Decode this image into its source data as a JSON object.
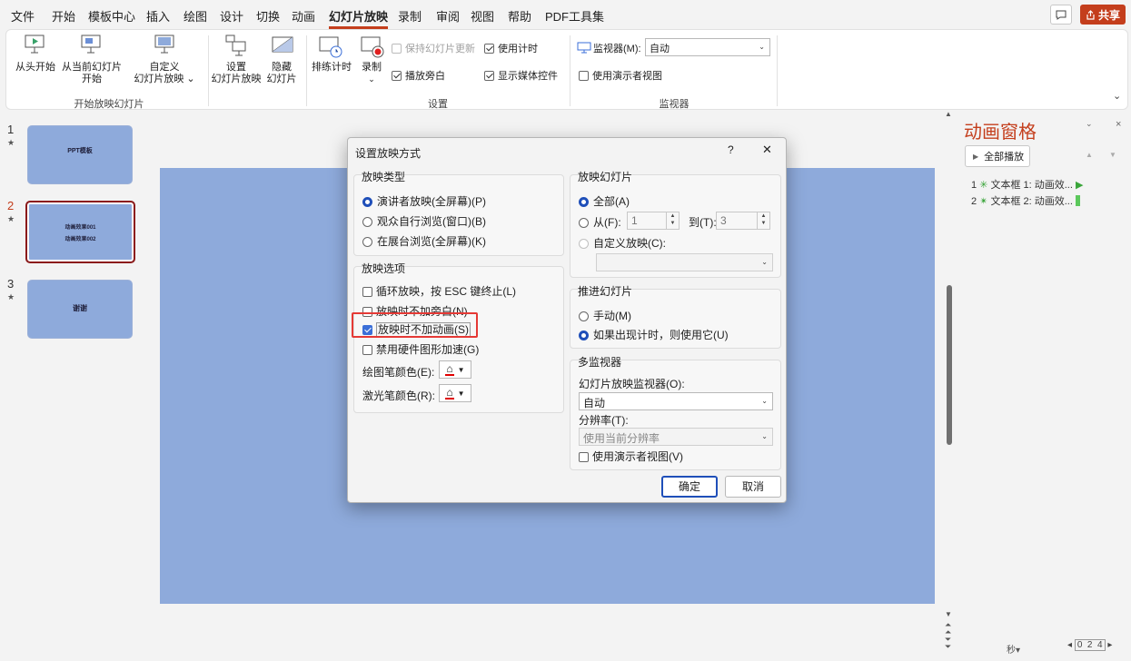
{
  "menu": [
    "文件",
    "开始",
    "模板中心",
    "插入",
    "绘图",
    "设计",
    "切换",
    "动画",
    "幻灯片放映",
    "录制",
    "审阅",
    "视图",
    "帮助",
    "PDF工具集"
  ],
  "menu_active_index": 8,
  "share_label": "共享",
  "ribbon": {
    "from_start": "从头开始",
    "from_current_l1": "从当前幻灯片",
    "from_current_l2": "开始",
    "custom_l1": "自定义",
    "custom_l2": "幻灯片放映",
    "group1_label": "开始放映幻灯片",
    "setup_l1": "设置",
    "setup_l2": "幻灯片放映",
    "hide_l1": "隐藏",
    "hide_l2": "幻灯片",
    "rehearse": "排练计时",
    "record": "录制",
    "keep_updated": "保持幻灯片更新",
    "use_timings": "使用计时",
    "play_narrations": "播放旁白",
    "show_media_controls": "显示媒体控件",
    "group2_label": "设置",
    "monitor_label": "监视器(M):",
    "monitor_value": "自动",
    "presenter_view": "使用演示者视图",
    "group3_label": "监视器"
  },
  "thumbnails": [
    {
      "num": "1",
      "star": "★",
      "text1": "PPT模板",
      "text2": ""
    },
    {
      "num": "2",
      "star": "★",
      "text1": "动画效果001",
      "text2": "动画效果002"
    },
    {
      "num": "3",
      "star": "★",
      "text1": "谢谢",
      "text2": ""
    }
  ],
  "anim_pane": {
    "title": "动画窗格",
    "play_all": "全部播放",
    "items": [
      {
        "num": "1",
        "label": "文本框 1: 动画效..."
      },
      {
        "num": "2",
        "label": "文本框 2: 动画效..."
      }
    ],
    "seconds": "秒▾",
    "timeline": "0  2  4"
  },
  "dialog": {
    "title": "设置放映方式",
    "help": "?",
    "close": "✕",
    "show_type": {
      "title": "放映类型",
      "options": [
        "演讲者放映(全屏幕)(P)",
        "观众自行浏览(窗口)(B)",
        "在展台浏览(全屏幕)(K)"
      ],
      "selected": 0
    },
    "show_options": {
      "title": "放映选项",
      "loop": "循环放映，按 ESC 键终止(L)",
      "no_narration": "放映时不加旁白(N)",
      "no_animation": "放映时不加动画(S)",
      "no_hw_accel": "禁用硬件图形加速(G)",
      "pen_color": "绘图笔颜色(E):",
      "laser_color": "激光笔颜色(R):"
    },
    "show_slides": {
      "title": "放映幻灯片",
      "all": "全部(A)",
      "from": "从(F):",
      "from_value": "1",
      "to": "到(T):",
      "to_value": "3",
      "custom": "自定义放映(C):"
    },
    "advance": {
      "title": "推进幻灯片",
      "manual": "手动(M)",
      "timings": "如果出现计时，则使用它(U)"
    },
    "multi_monitor": {
      "title": "多监视器",
      "monitor_label": "幻灯片放映监视器(O):",
      "monitor_value": "自动",
      "resolution_label": "分辨率(T):",
      "resolution_value": "使用当前分辨率",
      "presenter_view": "使用演示者视图(V)"
    },
    "ok": "确定",
    "cancel": "取消"
  },
  "colors": {
    "accent": "#c43e1c",
    "slide_bg": "#8eaadb",
    "highlight": "#e53935"
  }
}
